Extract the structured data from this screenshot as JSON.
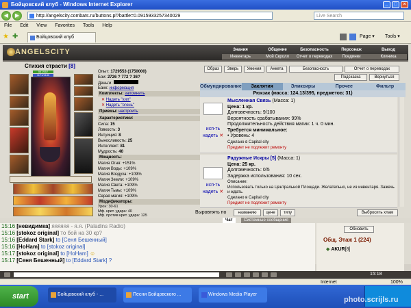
{
  "window": {
    "title": "Бойцовский клуб - Windows Internet Explorer"
  },
  "address": {
    "url": "http://angelscity.combats.ru/buttons.pl?battle=0.0915933257340029",
    "search_placeholder": "Live Search"
  },
  "menu": [
    "File",
    "Edit",
    "View",
    "Favorites",
    "Tools",
    "Help"
  ],
  "tab": {
    "label": "Бойцовский клуб"
  },
  "toolbar": {
    "page": "Page",
    "tools": "Tools"
  },
  "game": {
    "logo": "ANGELSCITY",
    "topnav": [
      "Знания",
      "Общение",
      "Безопасность",
      "Персонаж",
      "Выход"
    ],
    "subnav": [
      "Инвентарь",
      "Мой Скролл",
      "Отчет о переводах",
      "Поединки",
      "Клиника"
    ],
    "char": {
      "name": "Стихия страсти",
      "level": "[8]",
      "hp": "557/557",
      "mp": "1171/1180",
      "stats_top": [
        {
          "label": "Опыт:",
          "value": "1729553 (1750000)"
        },
        {
          "label": "Бои:",
          "value": "2726 ? 772 ? 36?"
        },
        {
          "label": "Деньги:",
          "value": ""
        },
        {
          "label": "Банк:",
          "value": "информация"
        }
      ],
      "sections": {
        "komplekty": "Комплекты:",
        "zapomnit": "запомнить",
        "priemy": "Приемы:",
        "nastroit": "настроить",
        "harakteristiki": "Характеристики:",
        "moshnost": "Мощность:",
        "modifikatory": "Модификаторы:"
      },
      "sets": [
        "Надеть \"хил\"",
        "Надеть \"огонь\""
      ],
      "attributes": [
        {
          "label": "Сила:",
          "value": "15"
        },
        {
          "label": "Ловкость:",
          "value": "3"
        },
        {
          "label": "Интуиция:",
          "value": "8"
        },
        {
          "label": "Выносливость:",
          "value": "25"
        },
        {
          "label": "Интеллект:",
          "value": "81"
        },
        {
          "label": "Мудрость:",
          "value": "40"
        }
      ],
      "power": [
        {
          "label": "Магия Огня:",
          "value": "+151%"
        },
        {
          "label": "Магия Воды:",
          "value": "+109%"
        },
        {
          "label": "Магия Воздуха:",
          "value": "+109%"
        },
        {
          "label": "Магия Земли:",
          "value": "+109%"
        },
        {
          "label": "Магия Света:",
          "value": "+109%"
        },
        {
          "label": "Магия Тьмы:",
          "value": "+109%"
        },
        {
          "label": "Серая магия:",
          "value": "+109%"
        }
      ],
      "modifiers": [
        {
          "label": "Урон:",
          "value": "30-61"
        },
        {
          "label": "Мф. крит. удара:",
          "value": "40"
        },
        {
          "label": "Мф. против крит. удара:",
          "value": "125"
        },
        {
          "label": "Мф. увертывания:",
          "value": "15"
        },
        {
          "label": "Мф. против увертывания:",
          "value": "15"
        },
        {
          "label": "Мф. контрудара:",
          "value": "10"
        },
        {
          "label": "Мф. парирования:",
          "value": ""
        }
      ]
    },
    "buttons": {
      "obraz": "Образ",
      "zver": "Зверь",
      "umeniya": "Умения",
      "anketa": "Анкета",
      "bezopasnost": "Безопасность",
      "otchet": "Отчет о переводах",
      "podskazka": "Подсказка",
      "vernutsya": "Вернуться"
    },
    "inventory": {
      "tabs": [
        "Обмундирование",
        "Заклятия",
        "Эликсиры",
        "Прочее",
        "Фильтр"
      ],
      "active_tab": 1,
      "header": "Рюкзак (масса: 124.13/395, предметов: 31)",
      "items": [
        {
          "name": "Мысленная Связь",
          "mass": "(Масса: 1)",
          "use": "исп-ть",
          "wear": "надеть",
          "price": "Цена: 1 кр.",
          "lines": [
            "Долговечность: 9/100",
            "Вероятность срабатывания: 99%",
            "Продолжительность действия магии: 1 ч. 0 мин."
          ],
          "req_title": "Требуется минимальное:",
          "req": "• Уровень: 4",
          "made": "Сделано в Capital city",
          "warn": "Предмет не подлежит ремонту"
        },
        {
          "name": "Радужные Искры [5]",
          "mass": "(Масса: 1)",
          "use": "исп-ть",
          "wear": "надеть",
          "price": "Цена: 25 кр.",
          "lines": [
            "Долговечность: 0/5",
            "Задержка использования: 10 сек."
          ],
          "desc_title": "Описание:",
          "desc": "Использовать только на Центральной Площади. Желательно, не из инвентаря. Зажечь и ждать.",
          "made": "Сделано в Capital city",
          "warn": "Предмет не подлежит ремонту"
        }
      ],
      "sort_label": "Выровнять по",
      "sort_buttons": [
        "названию",
        "цене",
        "типу"
      ],
      "discard": "Выбросить хлам"
    },
    "chat": {
      "tabs": [
        "Чат",
        "Системные сообщения"
      ],
      "lines": [
        {
          "time": "15:16",
          "nick": "[невидимка]",
          "to": "",
          "text": "яяяяяя - я.я."
        },
        {
          "time": "15:16",
          "nick": "[stokoz original]",
          "to": "",
          "text": "то бой на 30 кр?"
        },
        {
          "time": "15:16",
          "nick": "[Eddard Stark]",
          "to": "to [Сеня Бешенный]",
          "text": ""
        },
        {
          "time": "15:16",
          "nick": "[HoHam]",
          "to": "to [stokoz original]",
          "text": ""
        },
        {
          "time": "15:17",
          "nick": "[stokoz original]",
          "to": "to [HoHam]",
          "text": ""
        },
        {
          "time": "15:17",
          "nick": "[Сеня Бешенный]",
          "to": "to [Eddard Stark]",
          "text": "?"
        }
      ],
      "radio": "(Paladins Radio)",
      "online_button": "Обновить",
      "online_title": "Общ. Этаж 1 (224)",
      "online_first": "AKUR",
      "online_level": "[8]"
    }
  },
  "status": {
    "zone": "Internet",
    "zoom": "100%"
  },
  "taskbar": {
    "start": "start",
    "tasks": [
      "Бойцовский клуб - ...",
      "Песни Бойцовского ...",
      "Windows Media Player"
    ],
    "clock": "15:18"
  },
  "watermark": "photo.scrijls.ru"
}
